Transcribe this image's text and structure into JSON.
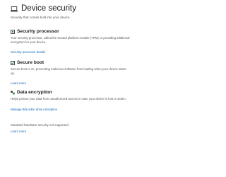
{
  "header": {
    "title": "Device security",
    "subtitle": "Security that comes built into your device.",
    "icon": "laptop-icon"
  },
  "sections": [
    {
      "icon": "security-processor-icon",
      "title": "Security processor",
      "description": "Your security processor, called the trusted platform module (TPM), is providing additional encryption for your device.",
      "link": "Security processor details"
    },
    {
      "icon": "secure-boot-icon",
      "title": "Secure boot",
      "description": "Secure boot is on, preventing malicious software from loading when your device starts up.",
      "link": "Learn more"
    },
    {
      "icon": "data-encryption-icon",
      "title": "Data encryption",
      "description": "Helps protect your data from unauthorized access in case your device is lost or stolen.",
      "link": "Manage BitLocker drive encryption"
    }
  ],
  "footer": {
    "note": "Standard hardware security not supported.",
    "link": "Learn more"
  },
  "colors": {
    "link": "#0a64b4",
    "icon_green": "#2e8b3d",
    "text": "#1b1b1b"
  }
}
